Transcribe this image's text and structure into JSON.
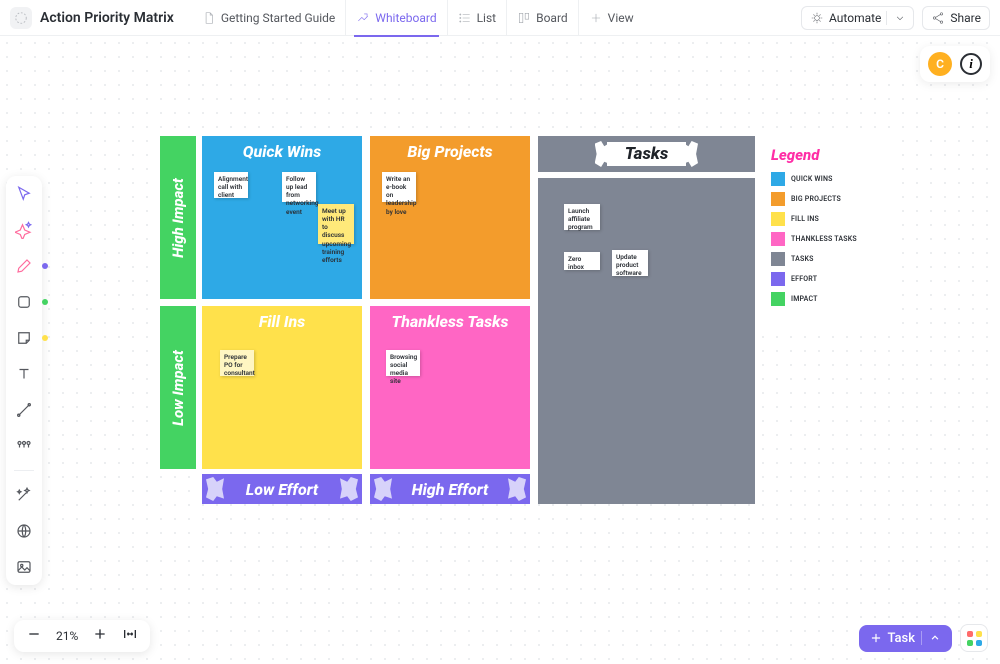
{
  "doc": {
    "title": "Action Priority Matrix"
  },
  "tabs": {
    "guide": "Getting Started Guide",
    "whiteboard": "Whiteboard",
    "list": "List",
    "board": "Board",
    "view": "View"
  },
  "buttons": {
    "automate": "Automate",
    "share": "Share",
    "task": "Task"
  },
  "avatar": {
    "initial": "C"
  },
  "axis": {
    "y_high": "High Impact",
    "y_low": "Low Impact",
    "x_low": "Low Effort",
    "x_high": "High Effort"
  },
  "quads": {
    "q1": "Quick Wins",
    "q2": "Big Projects",
    "q3": "Fill Ins",
    "q4": "Thankless Tasks"
  },
  "tasks_header": "Tasks",
  "legend": {
    "title": "Legend",
    "items": [
      {
        "label": "QUICK WINS",
        "color": "#2ea9e6"
      },
      {
        "label": "BIG PROJECTS",
        "color": "#f39c2c"
      },
      {
        "label": "FILL INS",
        "color": "#ffe14b"
      },
      {
        "label": "THANKLESS TASKS",
        "color": "#ff66c4"
      },
      {
        "label": "TASKS",
        "color": "#7f8694"
      },
      {
        "label": "EFFORT",
        "color": "#7b68ee"
      },
      {
        "label": "IMPACT",
        "color": "#44d362"
      }
    ]
  },
  "stickies": {
    "q1": [
      "Alignment call with client",
      "Follow up lead from networking event",
      "Meet up with HR to discuss upcoming training efforts"
    ],
    "q2": [
      "Write an e-book on leadership by love"
    ],
    "q3": [
      "Prepare PO for consultant"
    ],
    "q4": [
      "Browsing social media site"
    ],
    "tasks": [
      "Launch affiliate program",
      "Zero inbox",
      "Update product software"
    ]
  },
  "zoom": {
    "value": "21%"
  }
}
